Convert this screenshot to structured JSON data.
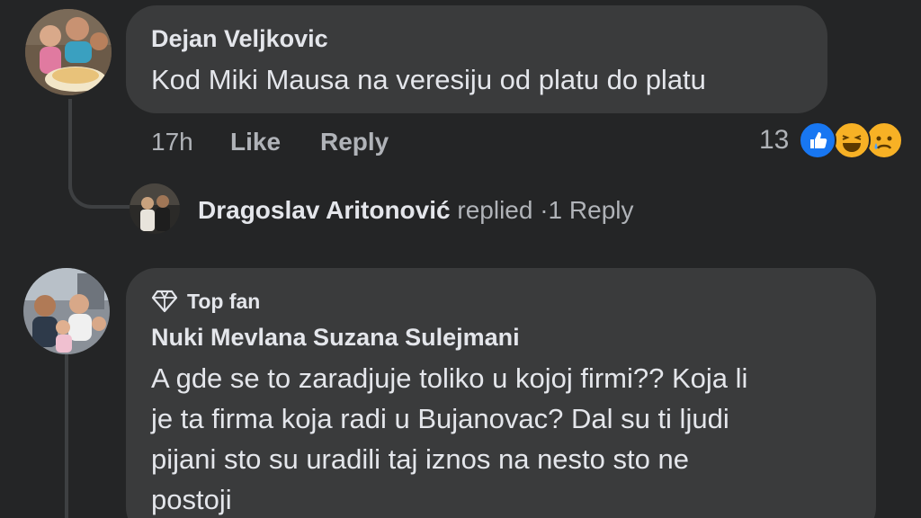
{
  "comments": [
    {
      "author": "Dejan Veljkovic",
      "text": "Kod Miki Mausa na veresiju od platu do platu",
      "time": "17h",
      "like_label": "Like",
      "reply_label": "Reply",
      "reaction_count": "13",
      "reactions": [
        "like-icon",
        "laugh-icon",
        "sad-icon"
      ]
    },
    {
      "badge": "Top fan",
      "author": "Nuki Mevlana Suzana Sulejmani",
      "text_lines": [
        "A gde se to zaradjuje toliko u kojoj firmi?? Koja li",
        "je ta firma koja radi u Bujanovac? Dal su ti ljudi",
        "pijani sto su uradili taj iznos na nesto sto ne",
        "postoji"
      ]
    }
  ],
  "reply_summary": {
    "author": "Dragoslav Aritonović",
    "action": "replied",
    "separator": "·",
    "count_label": "1 Reply"
  }
}
